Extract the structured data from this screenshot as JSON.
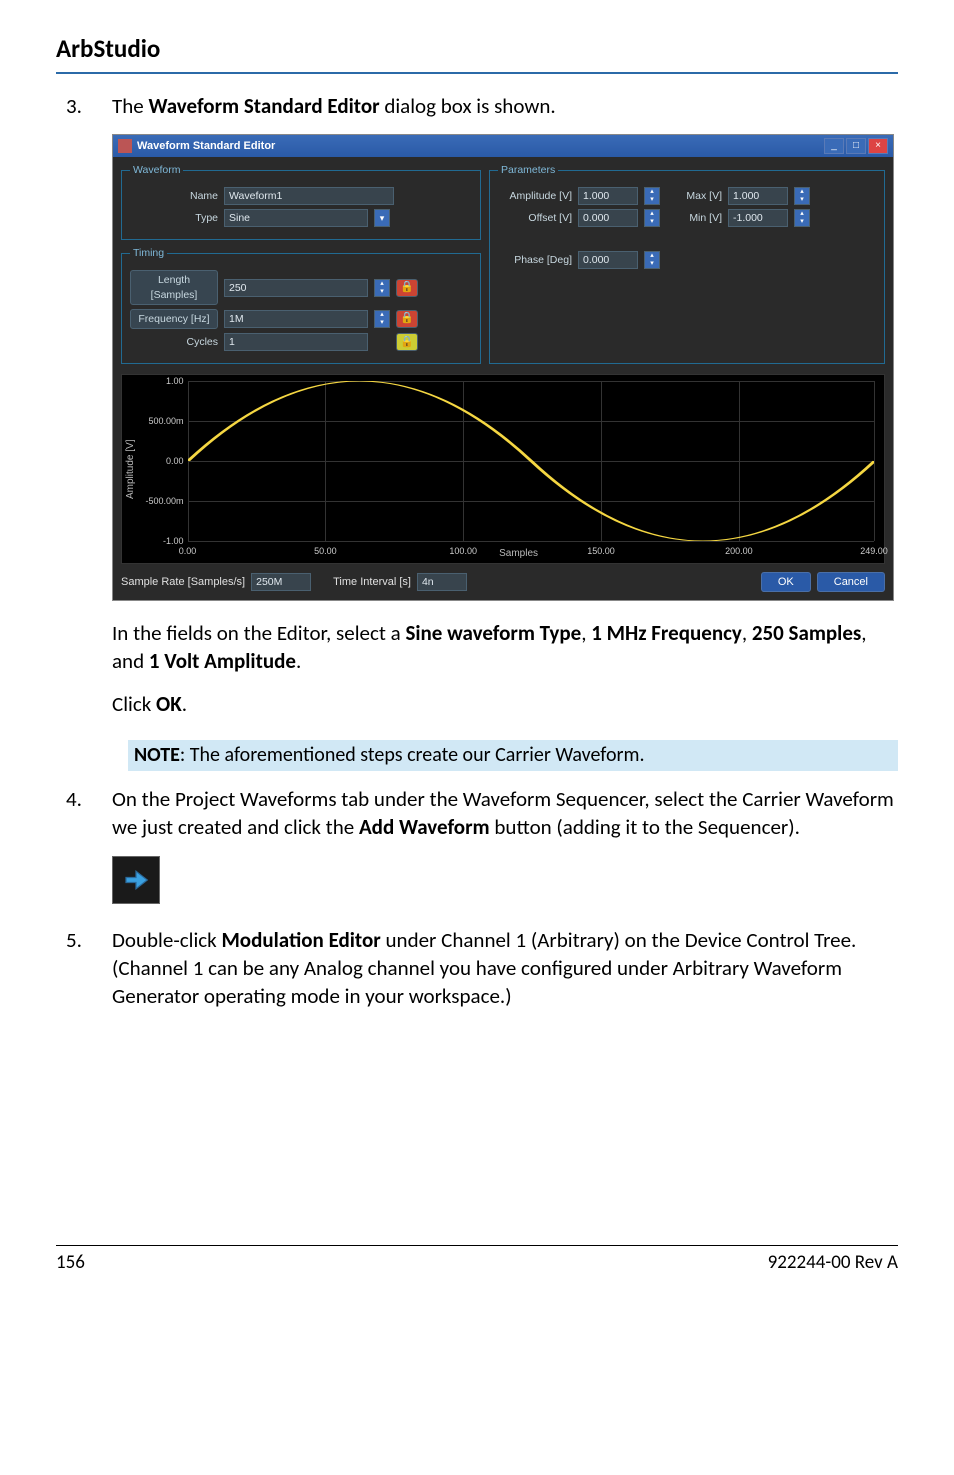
{
  "header": {
    "title": "ArbStudio"
  },
  "steps": {
    "s3": {
      "num": "3.",
      "intro_pre": "The ",
      "intro_bold": "Waveform Standard Editor",
      "intro_post": " dialog box is shown.",
      "after_pre": "In the fields on the Editor, select a ",
      "b1": "Sine waveform Type",
      "sep1": ", ",
      "b2": "1 MHz Frequency",
      "sep2": ", ",
      "b3": "250 Samples",
      "sep3": ", and ",
      "b4": "1 Volt Amplitude",
      "after_post": ".",
      "click_pre": "Click ",
      "click_b": "OK",
      "click_post": "."
    },
    "s4": {
      "num": "4.",
      "text_pre": "On the Project Waveforms tab under the Waveform Sequencer, select the Carrier Waveform we just created and click the ",
      "b1": "Add Waveform",
      "text_post": " button (adding it to the Sequencer)."
    },
    "s5": {
      "num": "5.",
      "text_pre": "Double-click ",
      "b1": "Modulation Editor",
      "text_post": " under Channel 1 (Arbitrary) on the Device Control Tree. (Channel 1 can be any Analog channel you have configured under Arbitrary Waveform Generator operating mode in your workspace.)"
    }
  },
  "note": {
    "label": "NOTE",
    "text": ": The aforementioned steps create our Carrier Waveform."
  },
  "dialog": {
    "title": "Waveform Standard Editor",
    "waveform": {
      "legend": "Waveform",
      "name_label": "Name",
      "name_value": "Waveform1",
      "type_label": "Type",
      "type_value": "Sine"
    },
    "timing": {
      "legend": "Timing",
      "length_label": "Length [Samples]",
      "length_value": "250",
      "freq_label": "Frequency [Hz]",
      "freq_value": "1M",
      "cycles_label": "Cycles",
      "cycles_value": "1"
    },
    "parameters": {
      "legend": "Parameters",
      "amplitude_label": "Amplitude [V]",
      "amplitude_value": "1.000",
      "offset_label": "Offset [V]",
      "offset_value": "0.000",
      "phase_label": "Phase [Deg]",
      "phase_value": "0.000",
      "max_label": "Max [V]",
      "max_value": "1.000",
      "min_label": "Min [V]",
      "min_value": "-1.000"
    },
    "footer": {
      "sr_label": "Sample Rate [Samples/s]",
      "sr_value": "250M",
      "ti_label": "Time Interval [s]",
      "ti_value": "4n",
      "ok": "OK",
      "cancel": "Cancel"
    }
  },
  "chart_data": {
    "type": "line",
    "title": "",
    "xlabel": "Samples",
    "ylabel": "Amplitude [V]",
    "xlim": [
      0,
      249
    ],
    "ylim": [
      -1.0,
      1.0
    ],
    "x_ticks": [
      0,
      50,
      100,
      150,
      200,
      249
    ],
    "x_tick_labels": [
      "0.00",
      "50.00",
      "100.00",
      "150.00",
      "200.00",
      "249.00"
    ],
    "y_ticks": [
      -1.0,
      -0.5,
      0.0,
      0.5,
      1.0
    ],
    "y_tick_labels": [
      "-1.00",
      "-500.00m",
      "0.00",
      "500.00m",
      "1.00"
    ],
    "series": [
      {
        "name": "Waveform1",
        "color": "#f5d742",
        "description": "sine, 1 cycle over 250 samples, amplitude 1.0, offset 0.0, phase 0 deg",
        "x": [
          0,
          25,
          50,
          75,
          100,
          125,
          150,
          175,
          200,
          225,
          249
        ],
        "values": [
          0.0,
          0.588,
          0.951,
          0.951,
          0.588,
          0.0,
          -0.588,
          -0.951,
          -0.951,
          -0.588,
          0.0
        ]
      }
    ]
  },
  "page_footer": {
    "left": "156",
    "right": "922244-00 Rev A"
  }
}
